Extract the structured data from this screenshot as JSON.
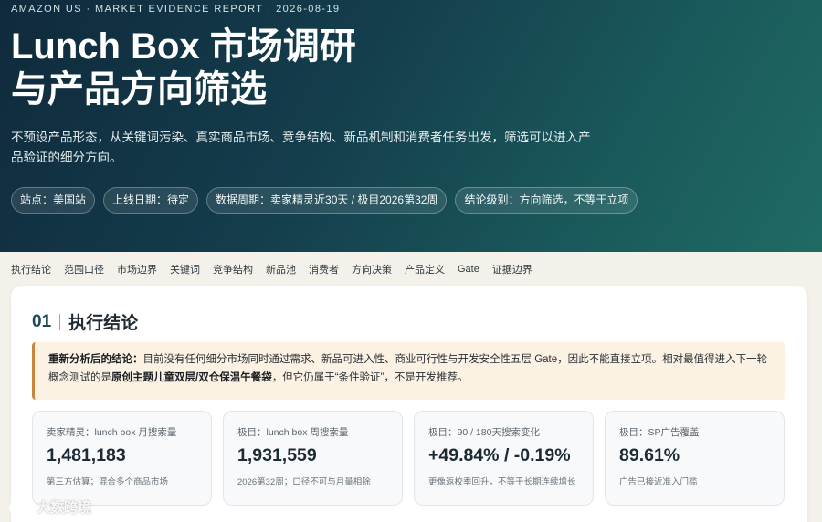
{
  "hero": {
    "eyebrow": "AMAZON US · MARKET EVIDENCE REPORT · 2026-08-19",
    "title_line1": "Lunch Box 市场调研",
    "title_line2": "与产品方向筛选",
    "lead": "不预设产品形态，从关键词污染、真实商品市场、竞争结构、新品机制和消费者任务出发，筛选可以进入产品验证的细分方向。",
    "pills": [
      "站点：美国站",
      "上线日期：待定",
      "数据周期：卖家精灵近30天 / 极目2026第32周",
      "结论级别：方向筛选，不等于立项"
    ]
  },
  "nav": {
    "items": [
      "执行结论",
      "范围口径",
      "市场边界",
      "关键词",
      "竞争结构",
      "新品池",
      "消费者",
      "方向决策",
      "产品定义",
      "Gate",
      "证据边界"
    ]
  },
  "section": {
    "number": "01",
    "title": "执行结论"
  },
  "callout": {
    "label": "重新分析后的结论：",
    "text1": "目前没有任何细分市场同时通过需求、新品可进入性、商业可行性与开发安全性五层 Gate，因此不能直接立项。相对最值得进入下一轮概念测试的是",
    "highlight": "原创主题儿童双层/双仓保温午餐袋",
    "text2": "，但它仍属于“条件验证”，不是开发推荐。"
  },
  "metrics": [
    {
      "label": "卖家精灵：lunch box 月搜索量",
      "value": "1,481,183",
      "note": "第三方估算；混合多个商品市场"
    },
    {
      "label": "极目：lunch box 周搜索量",
      "value": "1,931,559",
      "note": "2026第32周；口径不可与月量相除"
    },
    {
      "label": "极目：90 / 180天搜索变化",
      "value": "+49.84% / -0.19%",
      "note": "更像返校季回升，不等于长期连续增长"
    },
    {
      "label": "极目：SP广告覆盖",
      "value": "89.61%",
      "note": "广告已接近准入门槛"
    }
  ],
  "watermark": {
    "text": "大数跨境"
  }
}
